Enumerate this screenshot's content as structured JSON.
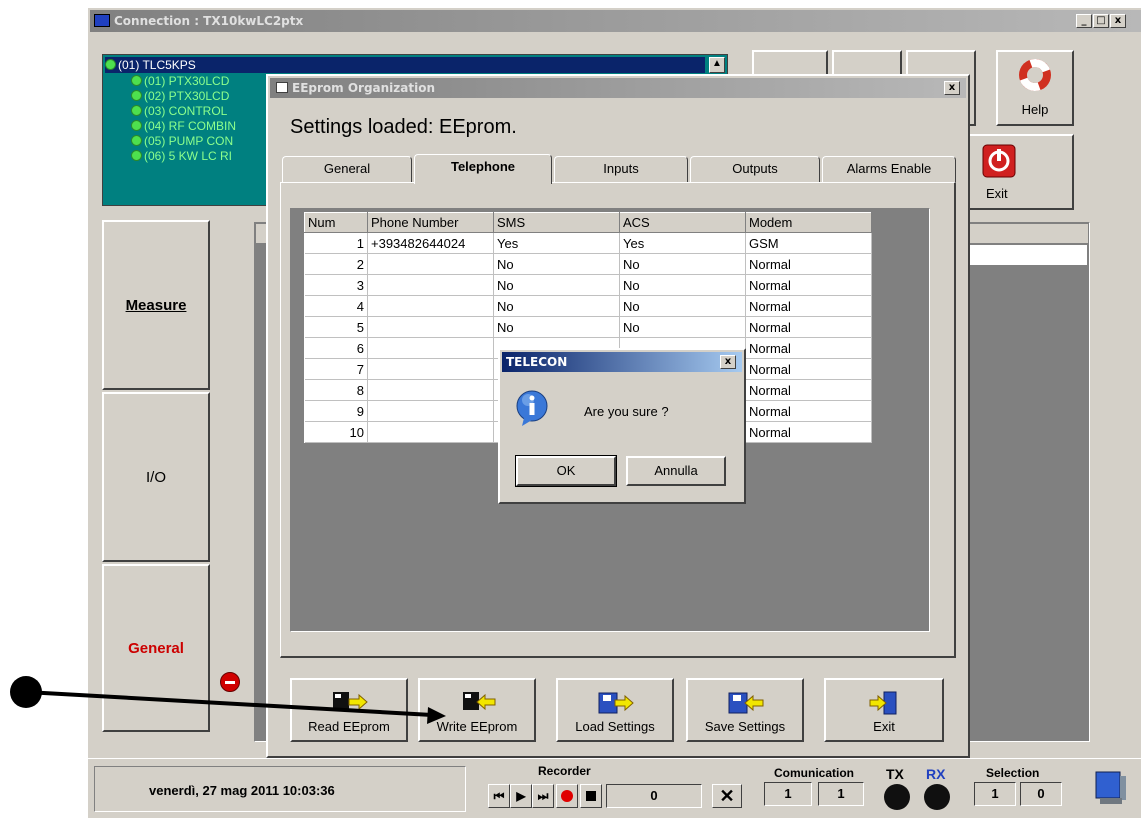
{
  "main_window": {
    "title": "Connection : TX10kwLC2ptx",
    "controls": [
      "_",
      "□",
      "x"
    ]
  },
  "tree": {
    "root": "(01) TLC5KPS",
    "children": [
      "(01) PTX30LCD",
      "(02) PTX30LCD",
      "(03) CONTROL",
      "(04) RF COMBIN",
      "(05) PUMP CON",
      "(06) 5 KW LC RI"
    ]
  },
  "nav": {
    "measure": "Measure",
    "io": "I/O",
    "general": "General"
  },
  "toolbar": {
    "help": "Help",
    "exit": "Exit"
  },
  "eeprom_dialog": {
    "title": "EEprom Organization",
    "heading": "Settings loaded:  EEprom.",
    "tabs": [
      "General",
      "Telephone",
      "Inputs",
      "Outputs",
      "Alarms Enable"
    ],
    "active_tab": "Telephone",
    "columns": [
      "Num",
      "Phone Number",
      "SMS",
      "ACS",
      "Modem"
    ],
    "rows": [
      [
        "1",
        "+393482644024",
        "Yes",
        "Yes",
        "GSM"
      ],
      [
        "2",
        "",
        "No",
        "No",
        "Normal"
      ],
      [
        "3",
        "",
        "No",
        "No",
        "Normal"
      ],
      [
        "4",
        "",
        "No",
        "No",
        "Normal"
      ],
      [
        "5",
        "",
        "No",
        "No",
        "Normal"
      ],
      [
        "6",
        "",
        "",
        "",
        "Normal"
      ],
      [
        "7",
        "",
        "",
        "",
        "Normal"
      ],
      [
        "8",
        "",
        "",
        "",
        "Normal"
      ],
      [
        "9",
        "",
        "",
        "",
        "Normal"
      ],
      [
        "10",
        "",
        "",
        "",
        "Normal"
      ]
    ],
    "buttons": {
      "read": "Read EEprom",
      "write": "Write EEprom",
      "load": "Load Settings",
      "save": "Save Settings",
      "exit": "Exit"
    }
  },
  "confirm_dialog": {
    "title": "TELECON",
    "message": "Are you sure ?",
    "ok": "OK",
    "cancel": "Annulla"
  },
  "statusbar": {
    "datetime": "venerdì, 27 mag 2011  10:03:36",
    "recorder_label": "Recorder",
    "recorder_count": "0",
    "comunication_label": "Comunication",
    "com_values": [
      "1",
      "1"
    ],
    "tx_label": "TX",
    "rx_label": "RX",
    "selection_label": "Selection",
    "selection_values": [
      "1",
      "0"
    ]
  },
  "colors": {
    "tree_bg": "#008080",
    "tree_text": "#8cff8c",
    "general_text": "#cc0000",
    "annotation": "#000000"
  }
}
